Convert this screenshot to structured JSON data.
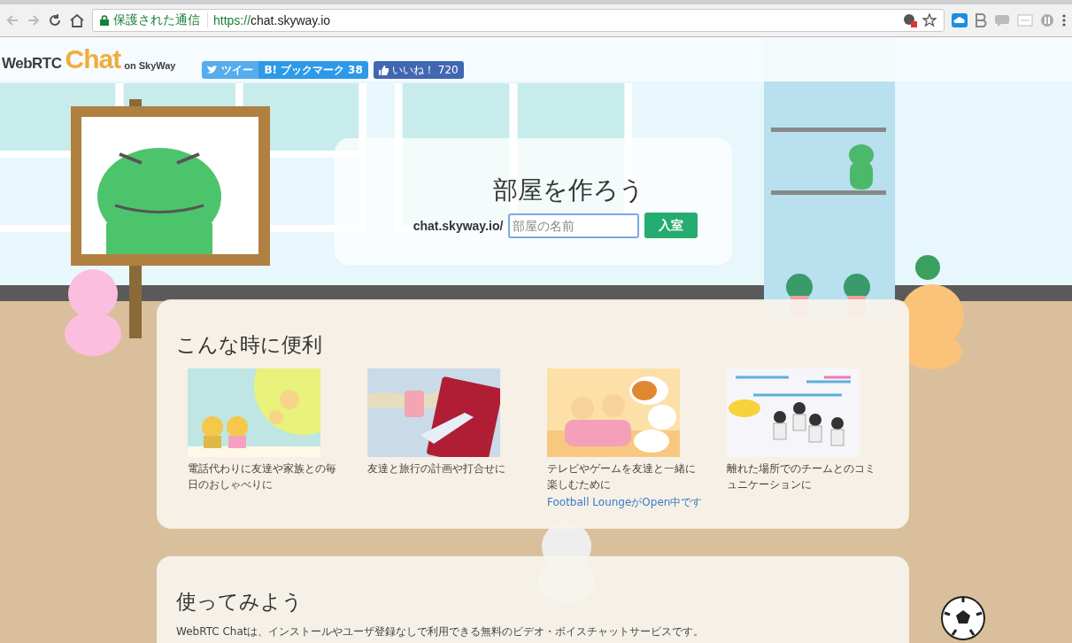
{
  "browser": {
    "secure_label": "保護された通信",
    "url_scheme": "https://",
    "url_host": "chat.skyway.io"
  },
  "header": {
    "logo_main": "WebRTC",
    "logo_chat": "Chat",
    "logo_sub": "on SkyWay",
    "share_buttons": [
      {
        "kind": "tweet",
        "label": "ツイー"
      },
      {
        "kind": "hatena",
        "mark": "B!",
        "label": "ブックマーク",
        "count": "38"
      },
      {
        "kind": "like",
        "label": "いいね！",
        "count": "720"
      }
    ]
  },
  "room": {
    "title": "部屋を作ろう",
    "prefix": "chat.skyway.io/",
    "placeholder": "部屋の名前",
    "button": "入室"
  },
  "features": {
    "title": "こんな時に便利",
    "items": [
      {
        "kind": "phone",
        "caption": "電話代わりに友達や家族との毎日のおしゃべりに"
      },
      {
        "kind": "travel",
        "caption": "友達と旅行の計画や打合せに"
      },
      {
        "kind": "game",
        "caption": "テレビやゲームを友達と一緒に楽しむために",
        "link": "Football LoungeがOpen中です"
      },
      {
        "kind": "team",
        "caption": "離れた場所でのチームとのコミュニケーションに"
      }
    ]
  },
  "intro": {
    "title": "使ってみよう",
    "text": "WebRTC Chatは、インストールやユーザ登録なしで利用できる無料のビデオ・ボイスチャットサービスです。"
  }
}
